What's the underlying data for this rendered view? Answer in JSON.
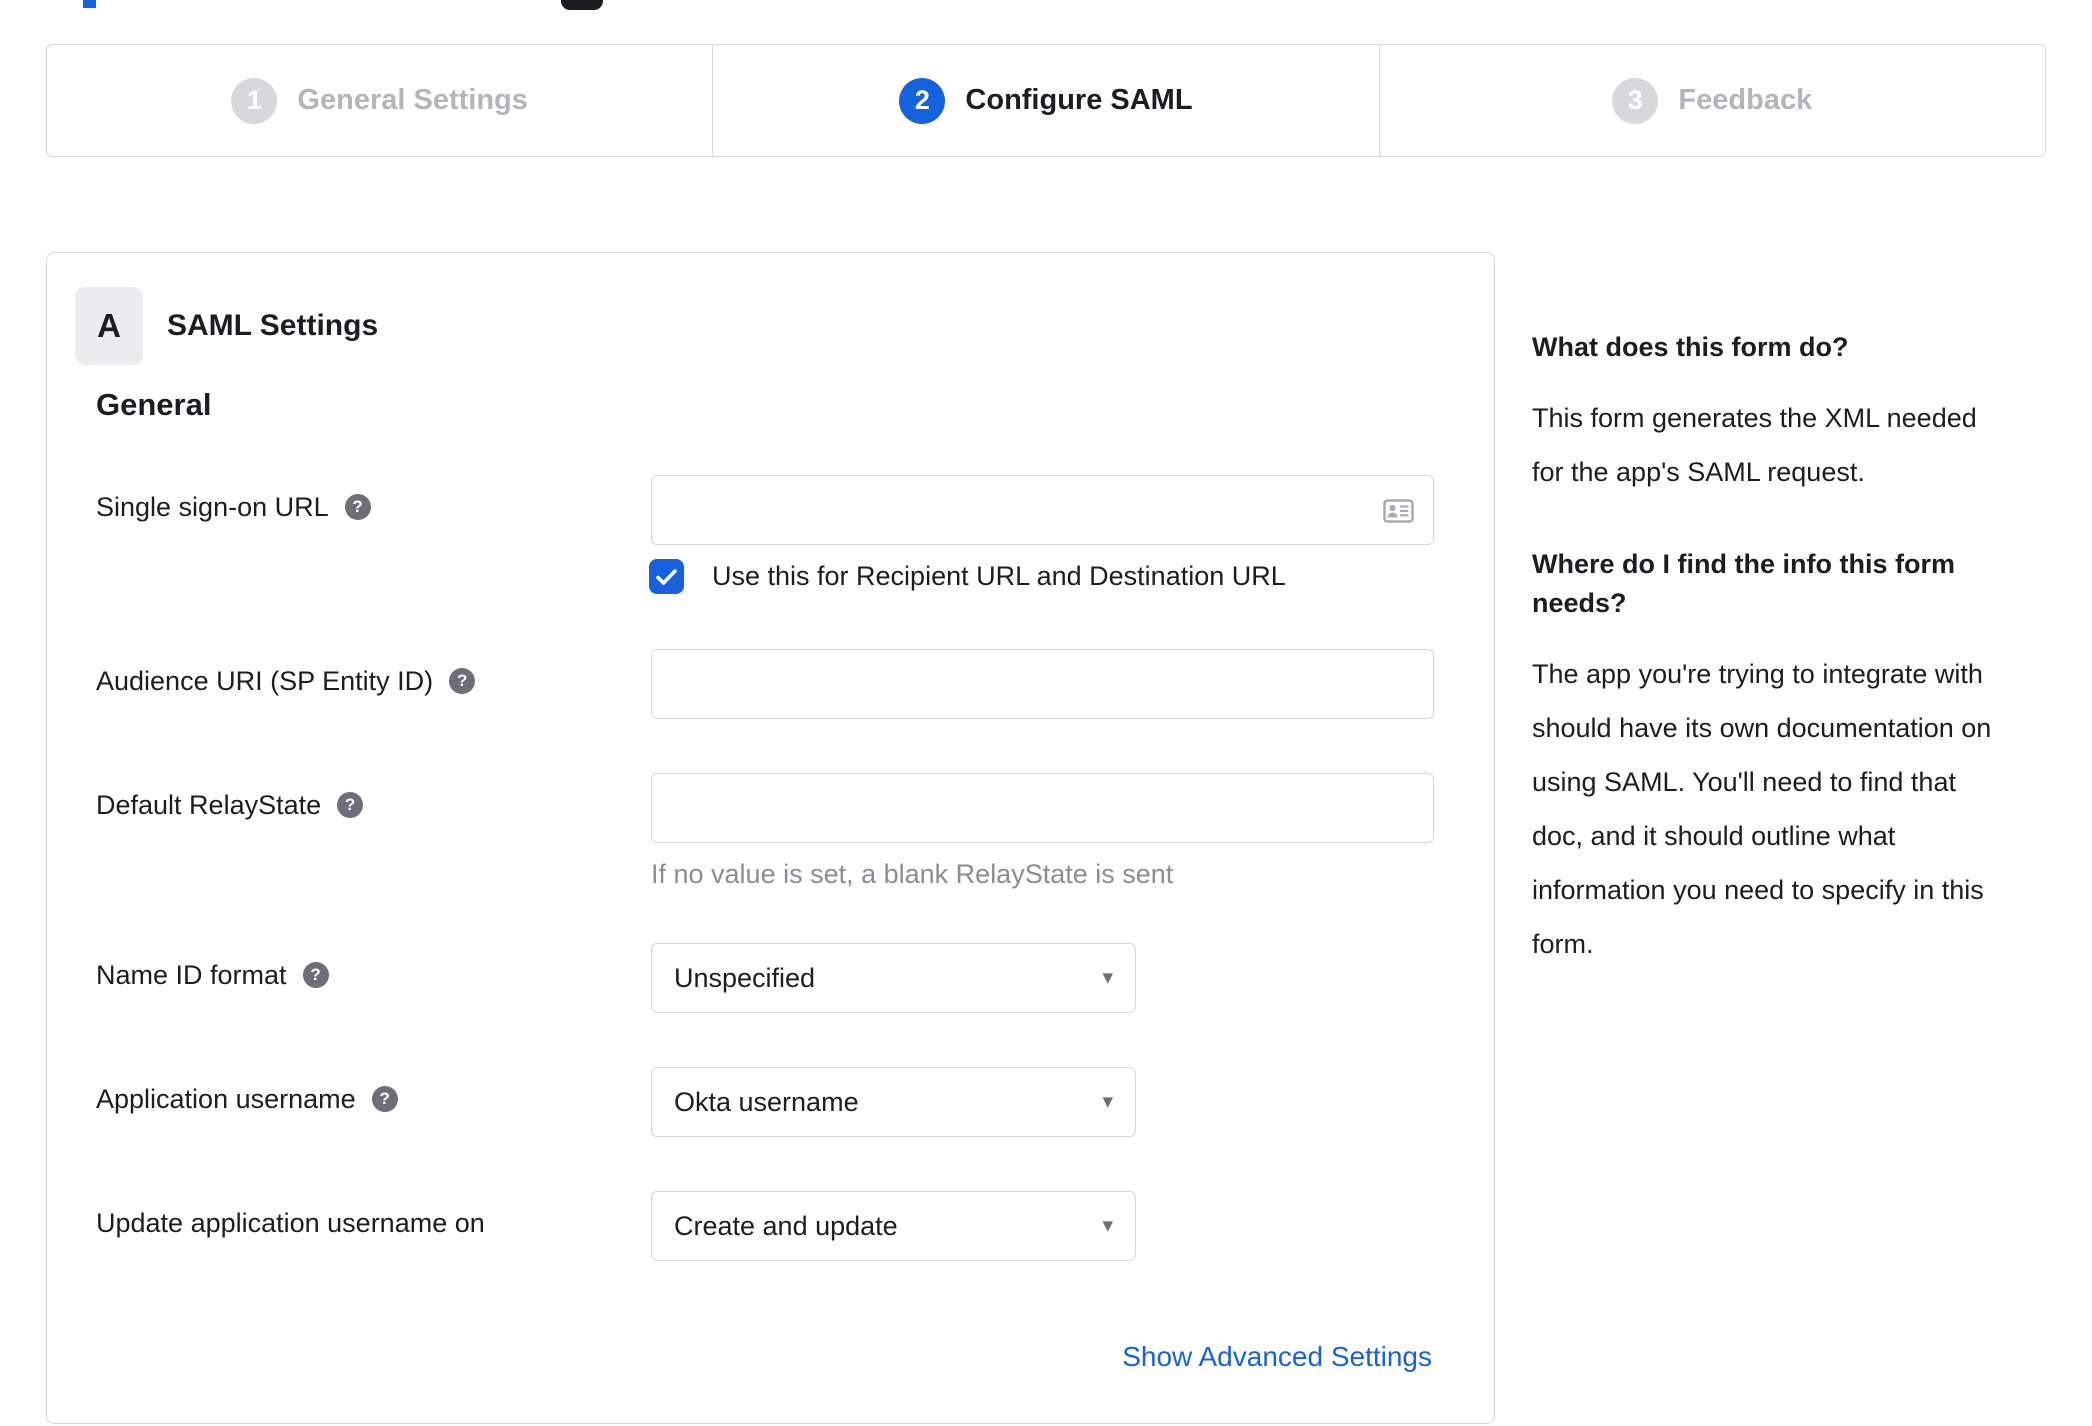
{
  "colors": {
    "accent_blue": "#1662dd",
    "text_dark": "#1d1d21",
    "muted_gray": "#8c8c96",
    "border_gray": "#d7d7dc",
    "inactive_step_gray": "#b4b4bb",
    "help_icon_bg": "#6e6e78"
  },
  "icons": {
    "help_glyph": "?",
    "dropdown_caret": "▾",
    "sso_input_icon": "contact-card",
    "checkbox_icon": "checkmark"
  },
  "stepper": {
    "steps": [
      {
        "number": "1",
        "label": "General Settings",
        "state": "inactive"
      },
      {
        "number": "2",
        "label": "Configure SAML",
        "state": "active"
      },
      {
        "number": "3",
        "label": "Feedback",
        "state": "inactive"
      }
    ]
  },
  "form": {
    "badge": "A",
    "section_title": "SAML Settings",
    "group_title": "General",
    "rows": [
      {
        "label": "Single sign-on URL",
        "control": "text",
        "value": ""
      },
      {
        "label": "Audience URI (SP Entity ID)",
        "control": "text",
        "value": ""
      },
      {
        "label": "Default RelayState",
        "control": "text",
        "value": "",
        "hint": "If no value is set, a blank RelayState is sent"
      },
      {
        "label": "Name ID format",
        "control": "select",
        "value": "Unspecified"
      },
      {
        "label": "Application username",
        "control": "select",
        "value": "Okta username"
      },
      {
        "label": "Update application username on",
        "control": "select",
        "value": "Create and update"
      }
    ],
    "sso_checkbox": {
      "state": "checked",
      "label": "Use this for Recipient URL and Destination URL"
    },
    "advanced_link": "Show Advanced Settings"
  },
  "sidebar": {
    "sections": [
      {
        "heading": "What does this form do?",
        "body": "This form generates the XML needed\nfor the app's SAML request."
      },
      {
        "heading": "Where do I find the info this form\nneeds?",
        "body": "The app you're trying to integrate with\nshould have its own documentation on\nusing SAML. You'll need to find that\ndoc, and it should outline what\ninformation you need to specify in this\nform."
      }
    ]
  }
}
